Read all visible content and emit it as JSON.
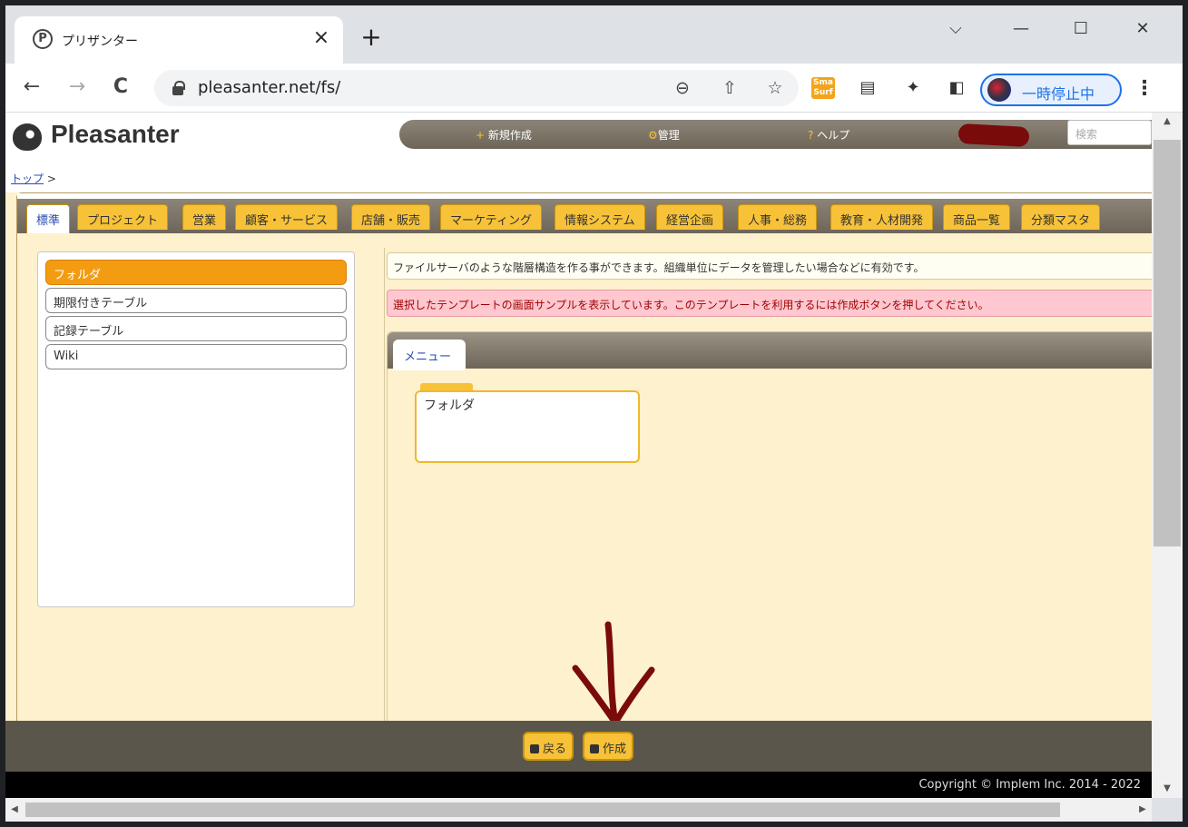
{
  "browser": {
    "tab_title": "プリザンター",
    "favicon_letter": "P",
    "tab_close": "×",
    "new_tab": "+",
    "url": "pleasanter.net/fs/",
    "profile_label": "一時停止中",
    "ext_smasurf": "Sma Surf",
    "win_controls": {
      "chevron": "⌵",
      "minimize": "—",
      "maximize": "☐",
      "close": "✕"
    },
    "nav": {
      "back": "←",
      "forward": "→",
      "reload": "C"
    }
  },
  "app": {
    "logo_text": "Pleasanter",
    "nav": {
      "new": "新規作成",
      "manage": "管理",
      "help": "ヘルプ"
    },
    "search_placeholder": "検索",
    "breadcrumb": {
      "top": "トップ",
      "sep": ">"
    },
    "tabs": [
      "標準",
      "プロジェクト",
      "営業",
      "顧客・サービス",
      "店舗・販売",
      "マーケティング",
      "情報システム",
      "経営企画",
      "人事・総務",
      "教育・人材開発",
      "商品一覧",
      "分類マスタ"
    ],
    "templates": [
      "フォルダ",
      "期限付きテーブル",
      "記録テーブル",
      "Wiki"
    ],
    "info_text": "ファイルサーバのような階層構造を作る事ができます。組織単位にデータを管理したい場合などに有効です。",
    "warning_text": "選択したテンプレートの画面サンプルを表示しています。このテンプレートを利用するには作成ボタンを押してください。",
    "menu_tab": "メニュー",
    "folder_card": "フォルダ",
    "buttons": {
      "back": "戻る",
      "create": "作成"
    },
    "copyright": "Copyright © Implem Inc. 2014 - 2022"
  },
  "colors": {
    "accent": "#f7c238",
    "selected": "#f39c12",
    "annotation_arrow": "#7a0b0b"
  }
}
